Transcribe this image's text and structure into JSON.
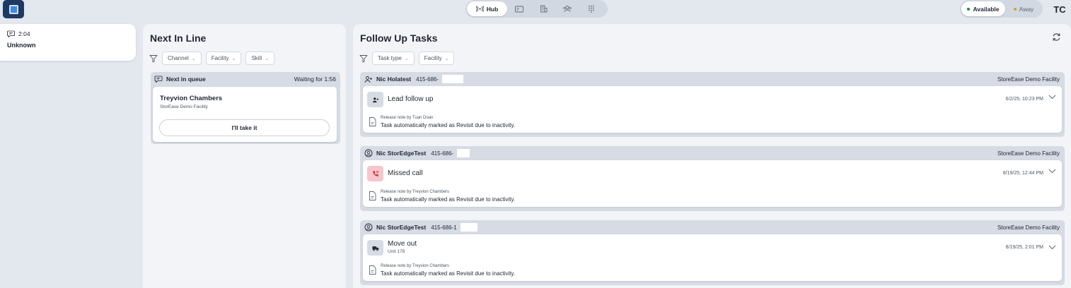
{
  "topbar": {
    "nav": {
      "hub_label": "Hub",
      "icons": [
        "broadcast-icon",
        "id-card-icon",
        "building-icon",
        "users-icon",
        "dialpad-icon"
      ]
    },
    "status": {
      "available_label": "Available",
      "away_label": "Away",
      "available_color": "#1f8a4c",
      "away_color": "#e0a21a"
    },
    "avatar_initials": "TC"
  },
  "conversation": {
    "time": "2:04",
    "name": "Unknown"
  },
  "next_in_line": {
    "title": "Next In Line",
    "filters": [
      "Channel",
      "Facility",
      "Skill"
    ],
    "queue": {
      "label": "Next in queue",
      "waiting": "Waiting for 1:56",
      "customer_name": "Treyvion Chambers",
      "facility": "StorEase Demo Facility",
      "take_label": "I'll take it"
    }
  },
  "follow_up": {
    "title": "Follow Up Tasks",
    "filters": [
      "Task type",
      "Facility"
    ],
    "tasks": [
      {
        "contact": "Nic Holatest",
        "phone": "415-686-",
        "facility": "StoreEase Demo Facility",
        "task_title": "Lead follow up",
        "task_sub": "",
        "date": "6/2/25, 10:23 PM",
        "note_by": "Release note by Tuan Doan",
        "note_text": "Task automatically marked as Revisit due to inactivity."
      },
      {
        "contact": "Nic StorEdgeTest",
        "phone": "415-686-",
        "facility": "StoreEase Demo Facility",
        "task_title": "Missed call",
        "task_sub": "",
        "date": "8/19/25, 12:44 PM",
        "note_by": "Release note by Treyvion Chambers",
        "note_text": "Task automatically marked as Revisit due to inactivity."
      },
      {
        "contact": "Nic StorEdgeTest",
        "phone": "415-686-1",
        "facility": "StoreEase Demo Facility",
        "task_title": "Move out",
        "task_sub": "Unit 178",
        "date": "8/19/25, 2:01 PM",
        "note_by": "Release note by Treyvion Chambers",
        "note_text": "Task automatically marked as Revisit due to inactivity."
      }
    ]
  }
}
